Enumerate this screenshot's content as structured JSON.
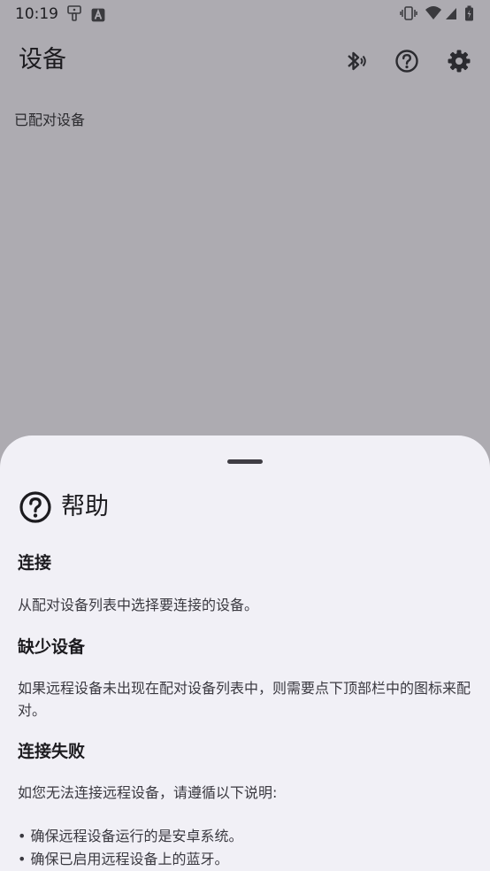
{
  "status_bar": {
    "time": "10:19",
    "icons": [
      "fingerprint-icon",
      "text-a-icon",
      "vibrate-icon",
      "wifi-icon",
      "signal-icon",
      "battery-icon"
    ]
  },
  "app_bar": {
    "title": "设备",
    "actions": [
      "bluetooth-icon",
      "help-icon",
      "settings-icon"
    ]
  },
  "devices": {
    "section_label": "已配对设备"
  },
  "help_sheet": {
    "title": "帮助",
    "sections": [
      {
        "heading": "连接",
        "body": "从配对设备列表中选择要连接的设备。"
      },
      {
        "heading": "缺少设备",
        "body": "如果远程设备未出现在配对设备列表中，则需要点下顶部栏中的图标来配对。"
      },
      {
        "heading": "连接失败",
        "body": "如您无法连接远程设备，请遵循以下说明:",
        "bullets": [
          "• 确保远程设备运行的是安卓系统。",
          "• 确保已启用远程设备上的蓝牙。"
        ]
      }
    ]
  },
  "colors": {
    "scrim_background": "#adabb1",
    "sheet_background": "#f1f0f6",
    "text_primary": "#1c1b1f"
  }
}
